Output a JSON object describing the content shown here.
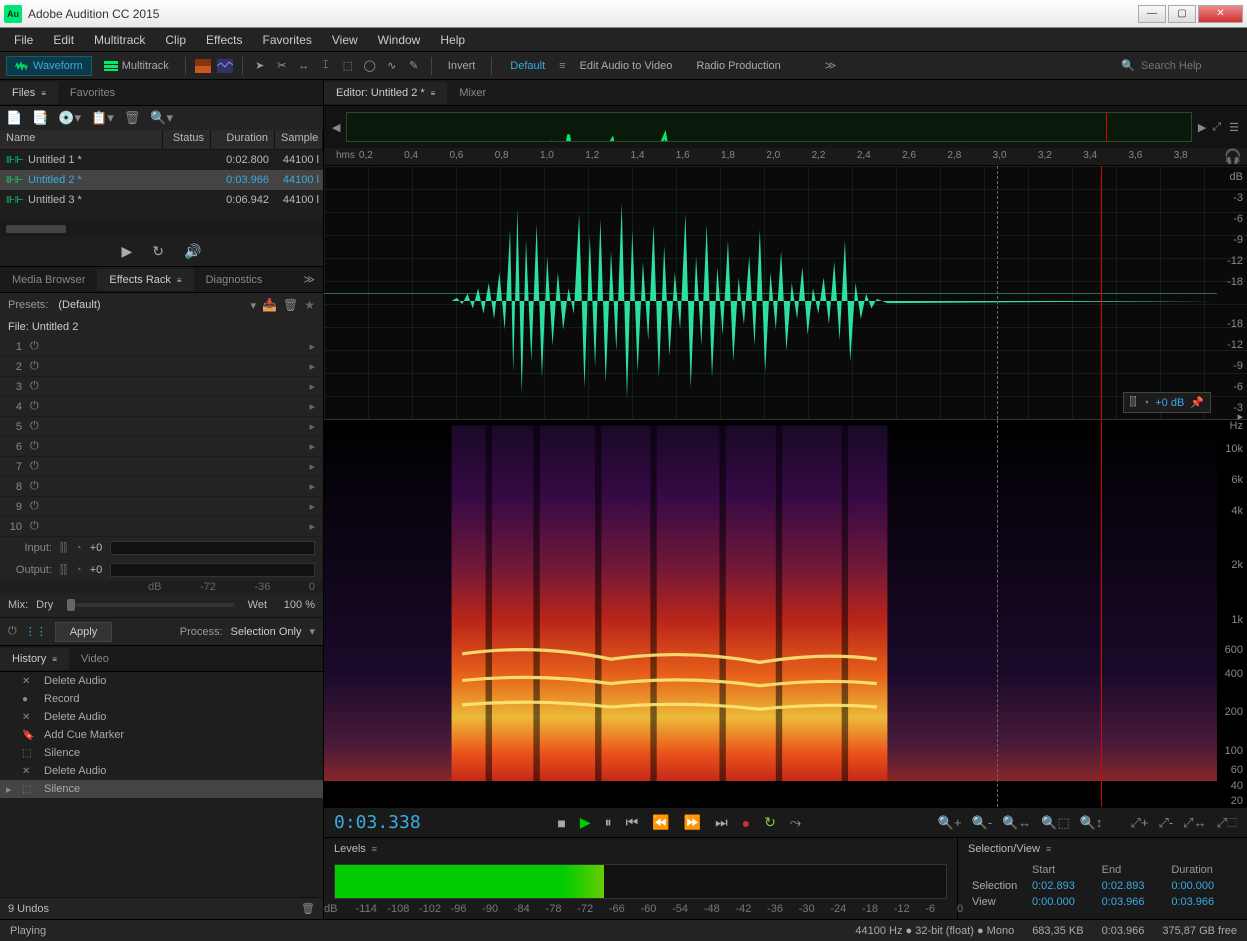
{
  "title": "Adobe Audition CC 2015",
  "menu": [
    "File",
    "Edit",
    "Multitrack",
    "Clip",
    "Effects",
    "Favorites",
    "View",
    "Window",
    "Help"
  ],
  "toolbar": {
    "waveform": "Waveform",
    "multitrack": "Multitrack",
    "invert": "Invert",
    "workspaces": [
      "Default",
      "Edit Audio to Video",
      "Radio Production"
    ],
    "search_placeholder": "Search Help"
  },
  "files_panel": {
    "tab_files": "Files",
    "tab_favorites": "Favorites",
    "cols": {
      "name": "Name",
      "status": "Status",
      "duration": "Duration",
      "sample": "Sample"
    },
    "rows": [
      {
        "name": "Untitled 1 *",
        "duration": "0:02.800",
        "sample": "44100 l"
      },
      {
        "name": "Untitled 2 *",
        "duration": "0:03.966",
        "sample": "44100 l"
      },
      {
        "name": "Untitled 3 *",
        "duration": "0:06.942",
        "sample": "44100 l"
      }
    ]
  },
  "effects_panel": {
    "tab_media": "Media Browser",
    "tab_rack": "Effects Rack",
    "tab_diag": "Diagnostics",
    "presets_label": "Presets:",
    "preset": "(Default)",
    "file_label": "File: Untitled 2",
    "slots": [
      "1",
      "2",
      "3",
      "4",
      "5",
      "6",
      "7",
      "8",
      "9",
      "10"
    ],
    "input_label": "Input:",
    "output_label": "Output:",
    "input_val": "+0",
    "output_val": "+0",
    "db_ticks": [
      "dB",
      "-72",
      "-36",
      "0"
    ],
    "mix_label": "Mix:",
    "dry": "Dry",
    "wet": "Wet",
    "mix_pct": "100 %",
    "apply": "Apply",
    "process_label": "Process:",
    "process_val": "Selection Only"
  },
  "history_panel": {
    "tab_history": "History",
    "tab_video": "Video",
    "items": [
      "Delete Audio",
      "Record",
      "Delete Audio",
      "Add Cue Marker",
      "Silence",
      "Delete Audio",
      "Silence"
    ],
    "undos": "9 Undos"
  },
  "editor": {
    "tab_editor": "Editor: Untitled 2 *",
    "tab_mixer": "Mixer",
    "ruler_unit": "hms",
    "ruler_ticks": [
      "0,2",
      "0,4",
      "0,6",
      "0,8",
      "1,0",
      "1,2",
      "1,4",
      "1,6",
      "1,8",
      "2,0",
      "2,2",
      "2,4",
      "2,6",
      "2,8",
      "3,0",
      "3,2",
      "3,4",
      "3,6",
      "3,8"
    ],
    "db_label": "dB",
    "db_scale": [
      "-3",
      "-6",
      "-9",
      "-12",
      "-18",
      "",
      "-18",
      "-12",
      "-9",
      "-6",
      "-3"
    ],
    "hud_db": "+0 dB",
    "hz_label": "Hz",
    "hz_scale": [
      {
        "v": "10k",
        "p": 6
      },
      {
        "v": "6k",
        "p": 14
      },
      {
        "v": "4k",
        "p": 22
      },
      {
        "v": "2k",
        "p": 36
      },
      {
        "v": "1k",
        "p": 50
      },
      {
        "v": "600",
        "p": 58
      },
      {
        "v": "400",
        "p": 64
      },
      {
        "v": "200",
        "p": 74
      },
      {
        "v": "100",
        "p": 84
      },
      {
        "v": "60",
        "p": 89
      },
      {
        "v": "40",
        "p": 93
      },
      {
        "v": "20",
        "p": 97
      }
    ],
    "timecode": "0:03.338"
  },
  "levels": {
    "label": "Levels",
    "ticks": [
      "dB",
      "-114",
      "-108",
      "-102",
      "-96",
      "-90",
      "-84",
      "-78",
      "-72",
      "-66",
      "-60",
      "-54",
      "-48",
      "-42",
      "-36",
      "-30",
      "-24",
      "-18",
      "-12",
      "-6",
      "0"
    ]
  },
  "selview": {
    "label": "Selection/View",
    "cols": [
      "",
      "Start",
      "End",
      "Duration"
    ],
    "rows": [
      {
        "label": "Selection",
        "start": "0:02.893",
        "end": "0:02.893",
        "dur": "0:00.000"
      },
      {
        "label": "View",
        "start": "0:00.000",
        "end": "0:03.966",
        "dur": "0:03.966"
      }
    ]
  },
  "status": {
    "playing": "Playing",
    "format": "44100 Hz ● 32-bit (float) ● Mono",
    "size": "683,35 KB",
    "dur": "0:03.966",
    "free": "375,87 GB free"
  }
}
